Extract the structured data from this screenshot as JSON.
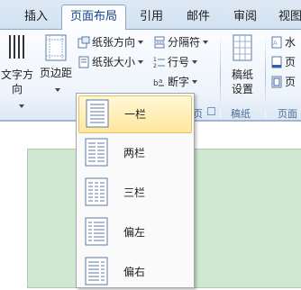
{
  "tabs": [
    {
      "label": "插入",
      "active": false
    },
    {
      "label": "页面布局",
      "active": true
    },
    {
      "label": "引用",
      "active": false
    },
    {
      "label": "邮件",
      "active": false
    },
    {
      "label": "审阅",
      "active": false
    },
    {
      "label": "视图",
      "active": false
    }
  ],
  "ribbon": {
    "text_direction": "文字方向",
    "margins": "页边距",
    "orientation": "纸张方向",
    "size": "纸张大小",
    "columns": "分栏",
    "breaks": "分隔符",
    "line_numbers": "行号",
    "hyphenation": "断字",
    "draft_paper": "稿纸\n设置",
    "draft_paper_top": "稿纸",
    "draft_paper_bottom": "设置",
    "group_page_setup_partial": "页",
    "group_draft": "稿纸",
    "group_background_partial": "页面",
    "watermark_partial": "水",
    "page_color_partial": "页",
    "page_border_partial": "页"
  },
  "columns_menu": [
    {
      "label": "一栏",
      "selected": true
    },
    {
      "label": "两栏",
      "selected": false
    },
    {
      "label": "三栏",
      "selected": false
    },
    {
      "label": "偏左",
      "selected": false
    },
    {
      "label": "偏右",
      "selected": false
    }
  ],
  "colors": {
    "accent": "#15428b",
    "ribbon_border": "#8ba7c8",
    "page": "#cfe8d2",
    "highlight": "#ffe79e"
  }
}
